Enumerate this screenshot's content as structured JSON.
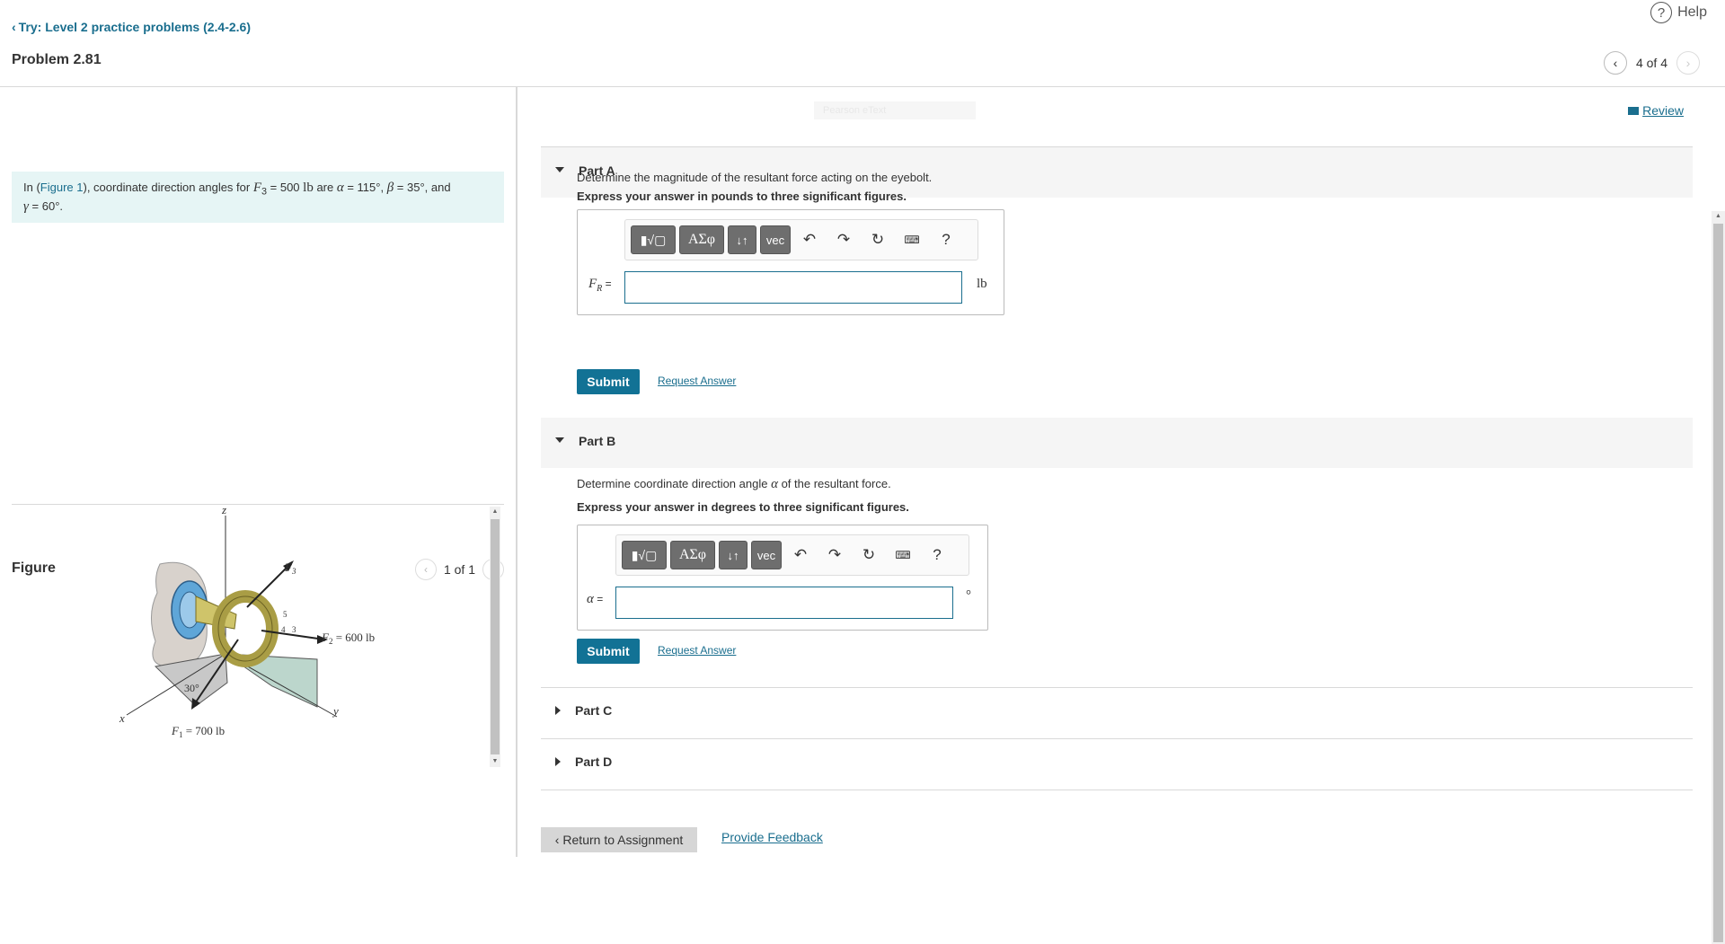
{
  "header": {
    "back_link": "Try: Level 2 practice problems (2.4-2.6)",
    "problem_title": "Problem 2.81",
    "help_label": "Help",
    "pager_text": "4 of 4"
  },
  "intro": {
    "prefix": "In (",
    "figure_link": "Figure 1",
    "text_1": "), coordinate direction angles for ",
    "f3_sym": "F",
    "f3_sub": "3",
    "text_2": " = 500 ",
    "unit_lb": "lb",
    "text_3": " are ",
    "alpha_sym": "α",
    "text_4": " = 115°, ",
    "beta_sym": "β",
    "text_5": " = 35°, and",
    "gamma_sym": "γ",
    "text_6": " = 60°."
  },
  "figure": {
    "title": "Figure",
    "pager_text": "1 of 1",
    "labels": {
      "z": "z",
      "x": "x",
      "y": "y",
      "f3": "F",
      "f3_sub": "3",
      "f2": "F",
      "f2_sub": "2",
      "f2_val": " = 600 lb",
      "f1": "F",
      "f1_sub": "1",
      "f1_val": " = 700 lb",
      "angle": "30°",
      "tri_5": "5",
      "tri_4": "4",
      "tri_3": "3"
    }
  },
  "review": {
    "label": "Review"
  },
  "faint_badge": "Pearson eText",
  "parts": {
    "a": {
      "title": "Part A",
      "prompt": "Determine the magnitude of the resultant force acting on the eyebolt.",
      "instruction": "Express your answer in pounds to three significant figures.",
      "var_sym": "F",
      "var_sub": "R",
      "var_eq": " =",
      "value": "",
      "unit": "lb",
      "submit": "Submit",
      "request": "Request Answer"
    },
    "b": {
      "title": "Part B",
      "prompt_1": "Determine coordinate direction angle ",
      "prompt_sym": "α",
      "prompt_2": " of the resultant force.",
      "instruction": "Express your answer in degrees to three significant figures.",
      "var_sym": "α",
      "var_eq": " =",
      "value": "",
      "unit": "°",
      "submit": "Submit",
      "request": "Request Answer"
    },
    "c": {
      "title": "Part C"
    },
    "d": {
      "title": "Part D"
    }
  },
  "toolbar": {
    "templates": "▮√▢",
    "greek": "ΑΣφ",
    "arrows": "↓↑",
    "vec": "vec",
    "undo": "↶",
    "redo": "↷",
    "reset": "↻",
    "keyboard": "⌨",
    "help": "?"
  },
  "footer": {
    "return": "Return to Assignment",
    "feedback": "Provide Feedback"
  }
}
